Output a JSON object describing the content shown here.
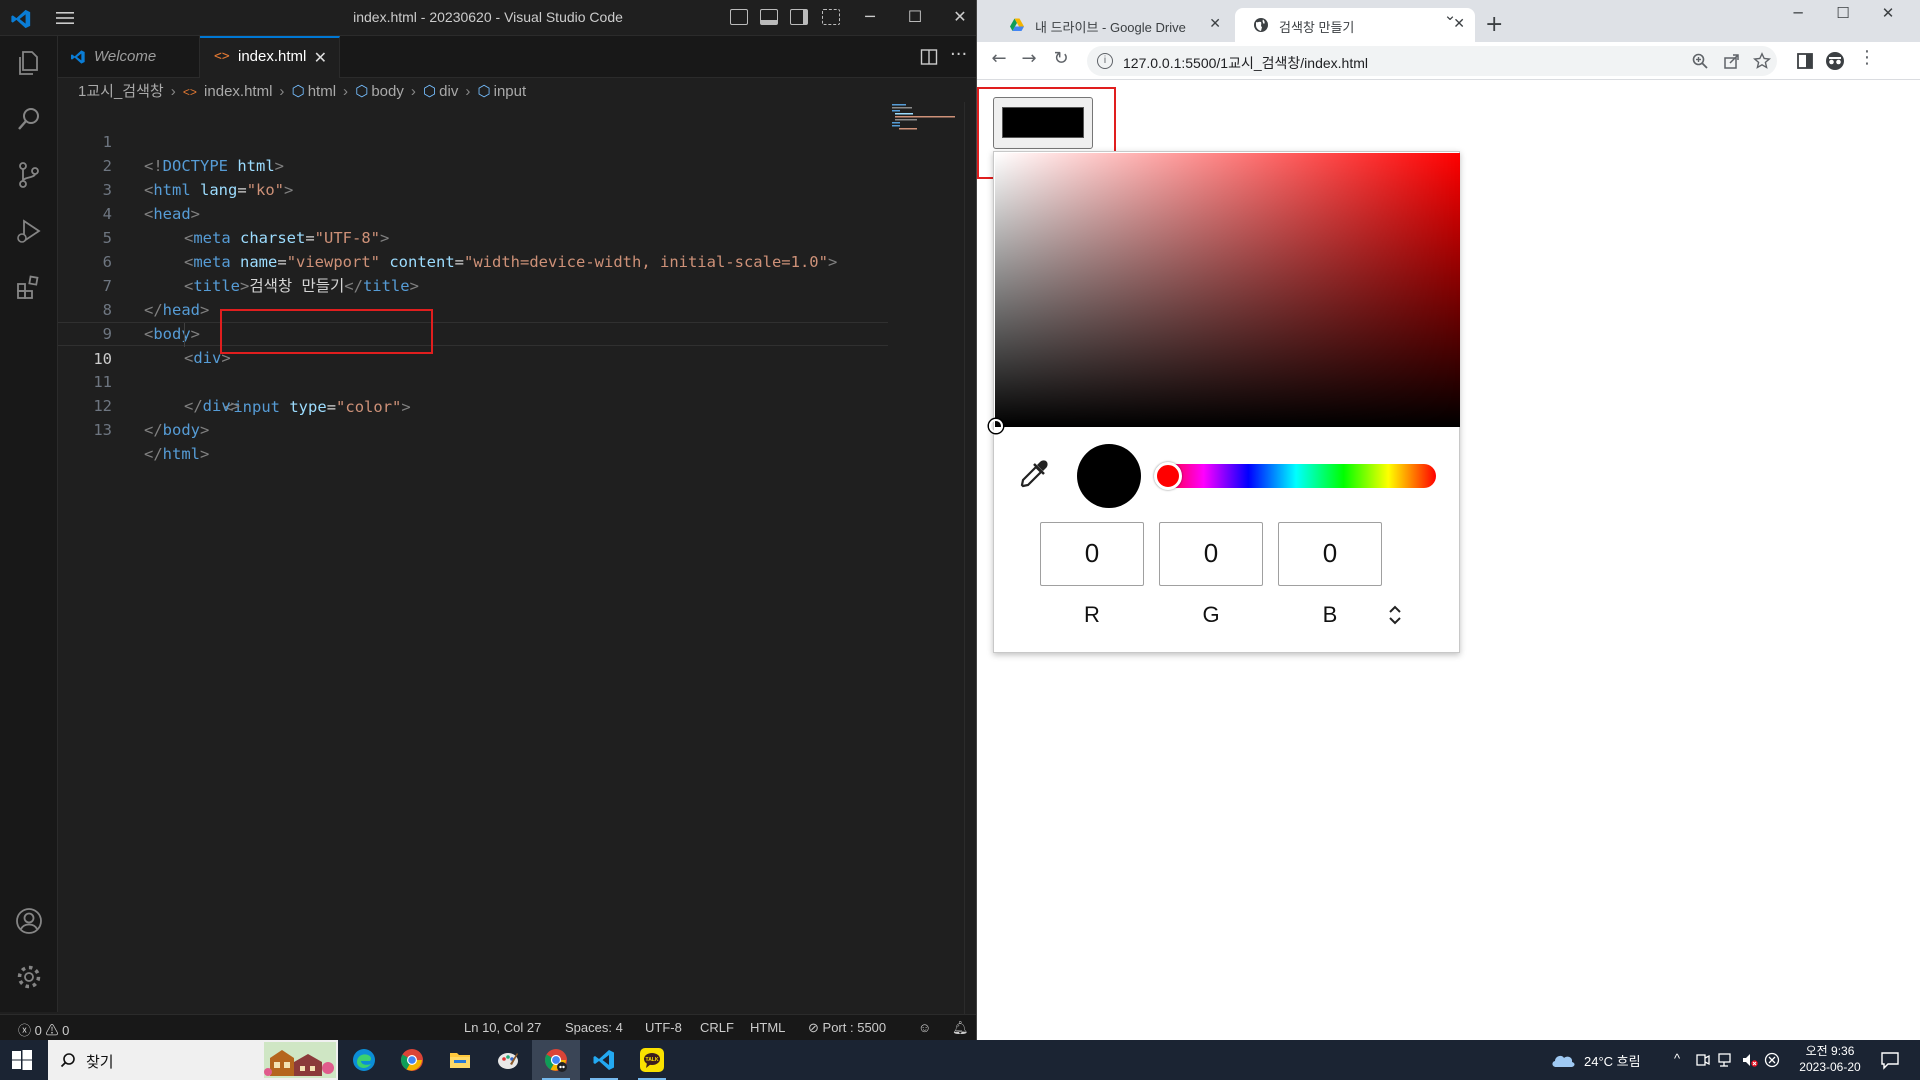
{
  "vscode": {
    "window_title": "index.html - 20230620 - Visual Studio Code",
    "tabs": [
      {
        "label": "Welcome"
      },
      {
        "label": "index.html",
        "close": "✕"
      }
    ],
    "breadcrumb": [
      "1교시_검색창",
      "index.html",
      "html",
      "body",
      "div",
      "input"
    ],
    "code_lines": [
      {
        "n": "1"
      },
      {
        "n": "2"
      },
      {
        "n": "3"
      },
      {
        "n": "4"
      },
      {
        "n": "5"
      },
      {
        "n": "6"
      },
      {
        "n": "7"
      },
      {
        "n": "8"
      },
      {
        "n": "9"
      },
      {
        "n": "10"
      },
      {
        "n": "11"
      },
      {
        "n": "12"
      },
      {
        "n": "13"
      }
    ],
    "code": {
      "l1": [
        "<!",
        "DOCTYPE",
        " html",
        ">"
      ],
      "l2": [
        "<",
        "html",
        " lang",
        "=",
        "\"ko\"",
        ">"
      ],
      "l3": [
        "<",
        "head",
        ">"
      ],
      "l4": [
        "<",
        "meta",
        " charset",
        "=",
        "\"UTF-8\"",
        ">"
      ],
      "l5": [
        "<",
        "meta",
        " name",
        "=",
        "\"viewport\"",
        " content",
        "=",
        "\"width=device-width, initial-scale=1.0\"",
        ">"
      ],
      "l6": [
        "<",
        "title",
        ">",
        "검색창 만들기",
        "</",
        "title",
        ">"
      ],
      "l7": [
        "</",
        "head",
        ">"
      ],
      "l8": [
        "<",
        "body",
        ">"
      ],
      "l9": [
        "<",
        "div",
        ">"
      ],
      "l10": [
        "<",
        "input",
        " type",
        "=",
        "\"color\"",
        ">"
      ],
      "l11": [
        "</",
        "div",
        ">"
      ],
      "l12": [
        "</",
        "body",
        ">"
      ],
      "l13": [
        "</",
        "html",
        ">"
      ]
    },
    "status": {
      "problems": "0",
      "warnings": "0",
      "position": "Ln 10, Col 27",
      "spaces": "Spaces: 4",
      "encoding": "UTF-8",
      "eol": "CRLF",
      "language": "HTML",
      "port": "Port : 5500"
    }
  },
  "chrome": {
    "tabs": [
      {
        "title": "내 드라이브 - Google Drive",
        "icon": "google-drive-icon"
      },
      {
        "title": "검색창 만들기",
        "icon": "globe-icon"
      }
    ],
    "new_tab": "+",
    "url": "127.0.0.1:5500/1교시_검색창/index.html",
    "color_input_value": "#000000",
    "picker": {
      "r": "0",
      "g": "0",
      "b": "0",
      "labels": [
        "R",
        "G",
        "B"
      ],
      "hue": "red",
      "preview_color": "#000000"
    }
  },
  "taskbar": {
    "search_placeholder": "찾기",
    "weather": "24°C  흐림",
    "time": "오전 9:36",
    "date": "2023-06-20"
  },
  "colors": {
    "vscode_bg": "#1f1f1f",
    "highlight_red": "#e01e1e",
    "accent_blue": "#0078d4"
  }
}
